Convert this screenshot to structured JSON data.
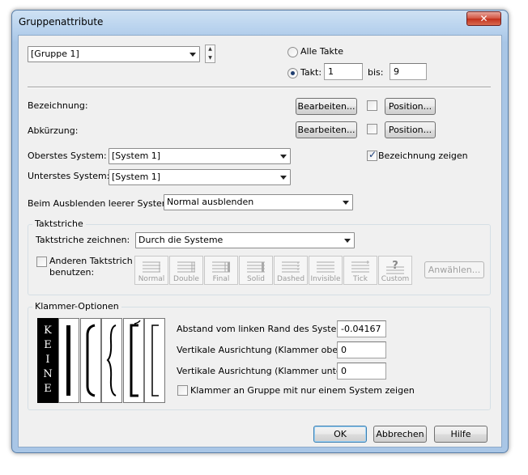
{
  "window": {
    "title": "Gruppenattribute",
    "close_label": "✕"
  },
  "group_select": {
    "value": "[Gruppe 1]"
  },
  "range": {
    "all_label": "Alle Takte",
    "takt_label": "Takt:",
    "from_value": "1",
    "bis_label": "bis:",
    "to_value": "9",
    "selected": "takt"
  },
  "bezeichnung": {
    "label": "Bezeichnung:",
    "edit_label": "Bearbeiten...",
    "position_label": "Position..."
  },
  "abkuerzung": {
    "label": "Abkürzung:",
    "edit_label": "Bearbeiten...",
    "position_label": "Position..."
  },
  "systems": {
    "top_label": "Oberstes System:",
    "top_value": "[System 1]",
    "bottom_label": "Unterstes System:",
    "bottom_value": "[System 1]",
    "show_name_label": "Bezeichnung zeigen",
    "show_name_checked": true
  },
  "hide": {
    "label": "Beim Ausblenden leerer Systeme:",
    "value": "Normal ausblenden"
  },
  "barlines": {
    "group_title": "Taktstriche",
    "draw_label": "Taktstriche zeichnen:",
    "draw_value": "Durch die Systeme",
    "other_label_1": "Anderen Taktstrich",
    "other_label_2": "benutzen:",
    "styles": [
      "Normal",
      "Double",
      "Final",
      "Solid",
      "Dashed",
      "Invisible",
      "Tick",
      "Custom"
    ],
    "choose_label": "Anwählen..."
  },
  "bracket": {
    "group_title": "Klammer-Optionen",
    "none_letters": [
      "K",
      "E",
      "I",
      "N",
      "E"
    ],
    "distance_label": "Abstand vom linken Rand des Systems:",
    "distance_value": "-0.04167",
    "valign_top_label": "Vertikale Ausrichtung (Klammer oben):",
    "valign_top_value": "0",
    "valign_bottom_label": "Vertikale Ausrichtung (Klammer unten):",
    "valign_bottom_value": "0",
    "single_label": "Klammer an Gruppe mit nur einem System zeigen"
  },
  "footer": {
    "ok_label": "OK",
    "cancel_label": "Abbrechen",
    "help_label": "Hilfe"
  }
}
